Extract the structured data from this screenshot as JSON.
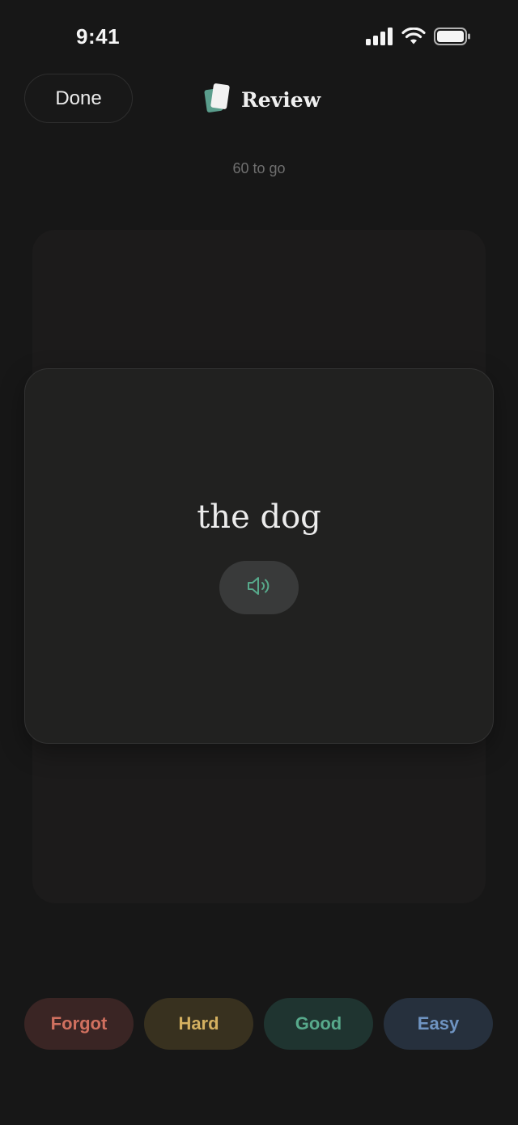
{
  "status_bar": {
    "time": "9:41",
    "signal_icon": "cellular-signal-icon",
    "wifi_icon": "wifi-icon",
    "battery_icon": "battery-icon"
  },
  "header": {
    "done_label": "Done",
    "title": "Review",
    "title_icon": "flashcards-icon"
  },
  "progress": {
    "remaining_text": "60 to go"
  },
  "card": {
    "word": "the dog",
    "audio_icon": "speaker-icon"
  },
  "ratings": [
    {
      "label": "Forgot",
      "color": "#d0705f"
    },
    {
      "label": "Hard",
      "color": "#d4b060"
    },
    {
      "label": "Good",
      "color": "#57a98b"
    },
    {
      "label": "Easy",
      "color": "#6f94c2"
    }
  ],
  "colors": {
    "background": "#171717",
    "card": "#212120",
    "accent": "#57a98b"
  }
}
